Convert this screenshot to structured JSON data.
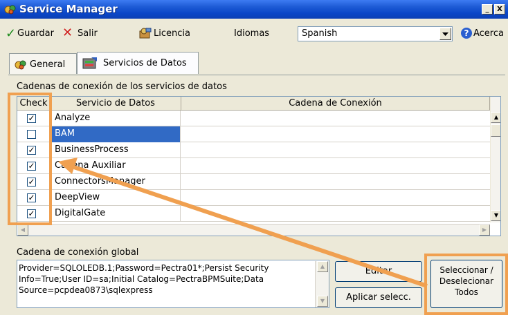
{
  "window": {
    "title": "Service Manager"
  },
  "toolbar": {
    "save_label": "Guardar",
    "exit_label": "Salir",
    "license_label": "Licencia",
    "language_label": "Idiomas",
    "language_value": "Spanish",
    "about_label": "Acerca"
  },
  "tabs": [
    {
      "label": "General"
    },
    {
      "label": "Servicios de Datos"
    }
  ],
  "section_label": "Cadenas de conexión de los servicios de datos",
  "grid": {
    "columns": [
      "Check",
      "Servicio de Datos",
      "Cadena de Conexión"
    ],
    "rows": [
      {
        "checked": true,
        "checkmark": "✓",
        "service": "Analyze",
        "connection": ""
      },
      {
        "checked": false,
        "checkmark": "",
        "service": "BAM",
        "connection": ""
      },
      {
        "checked": true,
        "checkmark": "✓",
        "service": "BusinessProcess",
        "connection": ""
      },
      {
        "checked": true,
        "checkmark": "✓",
        "service": "Cadena Auxiliar",
        "connection": ""
      },
      {
        "checked": true,
        "checkmark": "✓",
        "service": "ConnectorsManager",
        "connection": ""
      },
      {
        "checked": true,
        "checkmark": "✓",
        "service": "DeepView",
        "connection": ""
      },
      {
        "checked": true,
        "checkmark": "✓",
        "service": "DigitalGate",
        "connection": ""
      }
    ]
  },
  "global": {
    "label": "Cadena de conexión global",
    "value": "Provider=SQLOLEDB.1;Password=Pectra01*;Persist Security Info=True;User ID=sa;Initial Catalog=PectraBPMSuite;Data Source=pcpdea0873\\sqlexpress"
  },
  "buttons": {
    "edit": "Editar",
    "apply": "Aplicar selecc.",
    "toggle_all_1": "Seleccionar /",
    "toggle_all_2": "Deselecionar",
    "toggle_all_3": "Todos"
  },
  "colors": {
    "titlebar": "#0a46c8",
    "selection": "#316ac5",
    "annotation": "#f0a050",
    "save_check": "#1a8a1a",
    "exit_x": "#d02020"
  }
}
